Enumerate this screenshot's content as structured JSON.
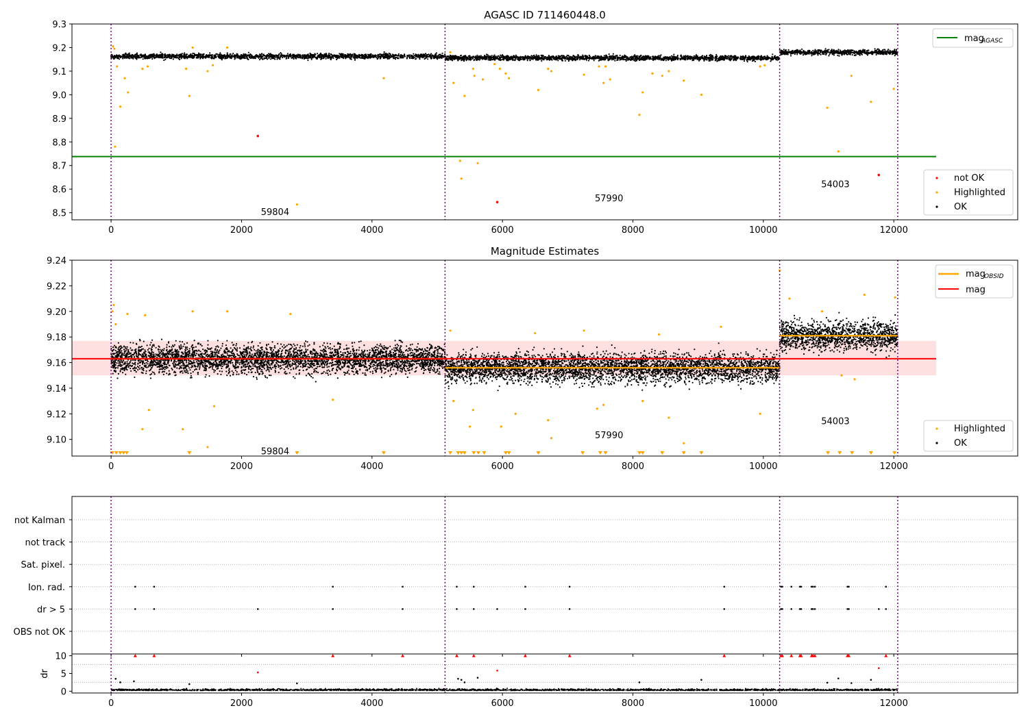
{
  "chart_data": [
    {
      "type": "scatter",
      "title": "AGASC ID 711460448.0",
      "xlim": [
        -600,
        13900
      ],
      "ylim": [
        8.47,
        9.3
      ],
      "x_ticks": [
        0,
        2000,
        4000,
        6000,
        8000,
        10000,
        12000
      ],
      "y_ticks": [
        8.5,
        8.6,
        8.7,
        8.8,
        8.9,
        9.0,
        9.1,
        9.2,
        9.3
      ],
      "obs_boundaries": [
        0,
        5120,
        10250,
        12060
      ],
      "obsids": [
        {
          "label": "59804",
          "x": 2560,
          "y": 8.505
        },
        {
          "label": "57990",
          "x": 7680,
          "y": 8.563
        },
        {
          "label": "54003",
          "x": 11150,
          "y": 8.622
        }
      ],
      "lines": [
        {
          "name": "mag_AGASC",
          "y": 8.738,
          "x_range": [
            -600,
            12650
          ],
          "color": "#008000"
        }
      ],
      "bands": [
        {
          "x_range": [
            0,
            5120
          ],
          "mean": 9.163,
          "std": 0.009
        },
        {
          "x_range": [
            5120,
            10250
          ],
          "mean": 9.156,
          "std": 0.009
        },
        {
          "x_range": [
            10250,
            12060
          ],
          "mean": 9.18,
          "std": 0.009
        }
      ],
      "highlighted": [
        [
          30,
          9.205
        ],
        [
          50,
          9.195
        ],
        [
          60,
          8.78
        ],
        [
          90,
          9.12
        ],
        [
          140,
          8.95
        ],
        [
          210,
          9.07
        ],
        [
          260,
          9.01
        ],
        [
          480,
          9.11
        ],
        [
          560,
          9.12
        ],
        [
          1150,
          9.11
        ],
        [
          1200,
          8.995
        ],
        [
          1250,
          9.2
        ],
        [
          1480,
          9.1
        ],
        [
          1560,
          9.125
        ],
        [
          1780,
          9.2
        ],
        [
          2850,
          8.535
        ],
        [
          4180,
          9.07
        ],
        [
          5200,
          9.18
        ],
        [
          5250,
          9.05
        ],
        [
          5350,
          8.72
        ],
        [
          5370,
          8.645
        ],
        [
          5420,
          8.995
        ],
        [
          5550,
          9.11
        ],
        [
          5570,
          9.08
        ],
        [
          5620,
          8.71
        ],
        [
          5700,
          9.065
        ],
        [
          5880,
          9.13
        ],
        [
          5960,
          9.11
        ],
        [
          6050,
          9.09
        ],
        [
          6100,
          9.07
        ],
        [
          6550,
          9.02
        ],
        [
          6700,
          9.11
        ],
        [
          6750,
          9.1
        ],
        [
          7250,
          9.085
        ],
        [
          7480,
          9.12
        ],
        [
          7550,
          9.05
        ],
        [
          7580,
          9.12
        ],
        [
          7650,
          9.065
        ],
        [
          8100,
          8.915
        ],
        [
          8150,
          9.01
        ],
        [
          8300,
          9.09
        ],
        [
          8450,
          9.08
        ],
        [
          8550,
          9.1
        ],
        [
          8780,
          9.06
        ],
        [
          9050,
          9.0
        ],
        [
          9950,
          9.12
        ],
        [
          10020,
          9.125
        ],
        [
          10980,
          8.945
        ],
        [
          11150,
          8.76
        ],
        [
          11350,
          9.08
        ],
        [
          11650,
          8.97
        ],
        [
          12000,
          9.025
        ]
      ],
      "not_ok": [
        [
          2250,
          8.825
        ],
        [
          5920,
          8.545
        ],
        [
          11770,
          8.66
        ]
      ],
      "legend": [
        {
          "label": "not OK",
          "color": "#ff0000"
        },
        {
          "label": "Highlighted",
          "color": "#ffa500"
        },
        {
          "label": "OK",
          "color": "#000000"
        }
      ],
      "legend_lines": [
        {
          "label": "mag",
          "sub": "AGASC",
          "color": "#008000"
        }
      ]
    },
    {
      "type": "scatter",
      "title": "Magnitude Estimates",
      "xlim": [
        -600,
        13900
      ],
      "ylim": [
        9.087,
        9.24
      ],
      "x_ticks": [
        0,
        2000,
        4000,
        6000,
        8000,
        10000,
        12000
      ],
      "y_ticks": [
        9.1,
        9.12,
        9.14,
        9.16,
        9.18,
        9.2,
        9.22,
        9.24
      ],
      "obs_boundaries": [
        0,
        5120,
        10250,
        12060
      ],
      "obsids": [
        {
          "label": "59804",
          "x": 2560,
          "y": 9.091
        },
        {
          "label": "57990",
          "x": 7680,
          "y": 9.1035
        },
        {
          "label": "54003",
          "x": 11150,
          "y": 9.1145
        }
      ],
      "mag_line": {
        "name": "mag",
        "y": 9.163,
        "band": [
          9.15,
          9.177
        ],
        "x_range": [
          -600,
          12650
        ],
        "color": "#ff0000"
      },
      "obsid_lines": [
        {
          "x_range": [
            5120,
            10250
          ],
          "y": 9.156
        },
        {
          "x_range": [
            10250,
            12060
          ],
          "y": 9.181
        }
      ],
      "highlighted": [
        [
          20,
          9.2
        ],
        [
          40,
          9.205
        ],
        [
          70,
          9.19
        ],
        [
          250,
          9.198
        ],
        [
          480,
          9.108
        ],
        [
          520,
          9.197
        ],
        [
          580,
          9.123
        ],
        [
          1100,
          9.108
        ],
        [
          1250,
          9.2
        ],
        [
          1480,
          9.094
        ],
        [
          1580,
          9.126
        ],
        [
          1780,
          9.2
        ],
        [
          2750,
          9.198
        ],
        [
          3400,
          9.131
        ],
        [
          5200,
          9.185
        ],
        [
          5250,
          9.13
        ],
        [
          5500,
          9.11
        ],
        [
          5550,
          9.123
        ],
        [
          5980,
          9.11
        ],
        [
          6200,
          9.12
        ],
        [
          6500,
          9.183
        ],
        [
          6700,
          9.115
        ],
        [
          6750,
          9.101
        ],
        [
          7250,
          9.185
        ],
        [
          7450,
          9.124
        ],
        [
          7550,
          9.127
        ],
        [
          8150,
          9.13
        ],
        [
          8400,
          9.182
        ],
        [
          8550,
          9.117
        ],
        [
          8780,
          9.097
        ],
        [
          9350,
          9.188
        ],
        [
          9950,
          9.12
        ],
        [
          10250,
          9.232
        ],
        [
          10400,
          9.21
        ],
        [
          10900,
          9.2
        ],
        [
          11200,
          9.15
        ],
        [
          11400,
          9.147
        ],
        [
          11550,
          9.213
        ],
        [
          12020,
          9.211
        ]
      ],
      "below_range": [
        20,
        80,
        140,
        190,
        240,
        1200,
        2850,
        4180,
        5200,
        5320,
        5370,
        5420,
        5560,
        5630,
        5720,
        6050,
        6100,
        6550,
        7230,
        7500,
        7580,
        8100,
        8150,
        8450,
        8780,
        9050,
        10990,
        11170,
        11360,
        11650,
        12010
      ],
      "legend": [
        {
          "label": "Highlighted",
          "color": "#ffa500"
        },
        {
          "label": "OK",
          "color": "#000000"
        }
      ],
      "legend_lines": [
        {
          "label": "mag",
          "sub": "OBSID",
          "color": "#ffa500"
        },
        {
          "label": "mag",
          "sub": "",
          "color": "#ff0000"
        }
      ]
    },
    {
      "type": "scatter",
      "title": "",
      "xlim": [
        -600,
        13900
      ],
      "categories": [
        "not Kalman",
        "not track",
        "Sat. pixel.",
        "Ion. rad.",
        "dr > 5",
        "OBS not OK"
      ],
      "obs_boundaries": [
        0,
        5120,
        10250,
        12060
      ],
      "flags": {
        "Ion. rad.": [
          370,
          660,
          3400,
          4470,
          5300,
          5560,
          6350,
          7030,
          9400,
          10270,
          10290,
          10430,
          10560,
          10580,
          10740,
          10760,
          10790,
          11290,
          11310,
          11880
        ],
        "dr > 5": [
          370,
          660,
          2250,
          3400,
          4470,
          5300,
          5560,
          5920,
          6350,
          7030,
          9400,
          10270,
          10290,
          10430,
          10560,
          10580,
          10740,
          10760,
          10790,
          11290,
          11310,
          11770,
          11880
        ]
      }
    },
    {
      "type": "scatter",
      "title": "",
      "ylabel": "dr",
      "xlim": [
        -600,
        13900
      ],
      "ylim": [
        -0.5,
        10.5
      ],
      "x_ticks": [
        0,
        2000,
        4000,
        6000,
        8000,
        10000,
        12000
      ],
      "y_ticks": [
        0,
        5,
        10
      ],
      "obs_boundaries": [
        0,
        5120,
        10250,
        12060
      ],
      "clipped_at_10": [
        370,
        660,
        3400,
        4470,
        5300,
        5560,
        6350,
        7030,
        9400,
        10270,
        10290,
        10430,
        10560,
        10580,
        10740,
        10760,
        10790,
        11290,
        11310,
        11880
      ],
      "mid_points": [
        [
          70,
          3.5
        ],
        [
          140,
          2.5
        ],
        [
          350,
          2.8
        ],
        [
          1200,
          2.0
        ],
        [
          2250,
          5.3
        ],
        [
          2850,
          2.2
        ],
        [
          5320,
          3.5
        ],
        [
          5370,
          3.2
        ],
        [
          5420,
          2.5
        ],
        [
          5620,
          3.8
        ],
        [
          5920,
          5.8
        ],
        [
          8100,
          2.5
        ],
        [
          9050,
          3.2
        ],
        [
          10980,
          2.4
        ],
        [
          11150,
          3.6
        ],
        [
          11350,
          2.3
        ],
        [
          11650,
          3.2
        ],
        [
          11770,
          6.5
        ]
      ]
    }
  ]
}
